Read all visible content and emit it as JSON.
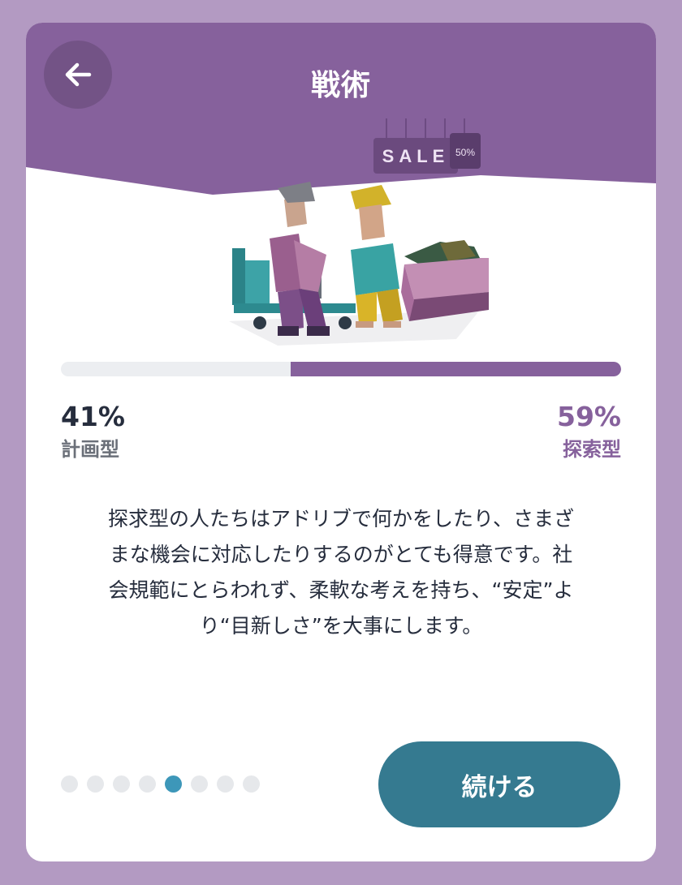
{
  "header": {
    "title": "戦術",
    "back_icon": "arrow-left-icon"
  },
  "illustration": {
    "sign_text": "SALE",
    "tag_text": "50%"
  },
  "progress": {
    "left_percent_value": 41,
    "right_percent_value": 59,
    "left_percent_label": "41%",
    "right_percent_label": "59%",
    "left_label": "計画型",
    "right_label": "探索型"
  },
  "description": {
    "lines": [
      "探求型の人たちはアドリブで何かをしたり、さまざ",
      "まな機会に対応したりするのがとても得意です。社",
      "会規範にとらわれず、柔軟な考えを持ち、“安定”よ",
      "り“目新しさ”を大事にします。"
    ]
  },
  "pager": {
    "total": 8,
    "active_index": 4
  },
  "actions": {
    "continue_label": "続ける"
  },
  "colors": {
    "background": "#b39ac2",
    "header": "#86619c",
    "accent_teal": "#357a90",
    "active_dot": "#3d97b9",
    "text_dark": "#262d3d",
    "text_muted": "#6b7079"
  }
}
